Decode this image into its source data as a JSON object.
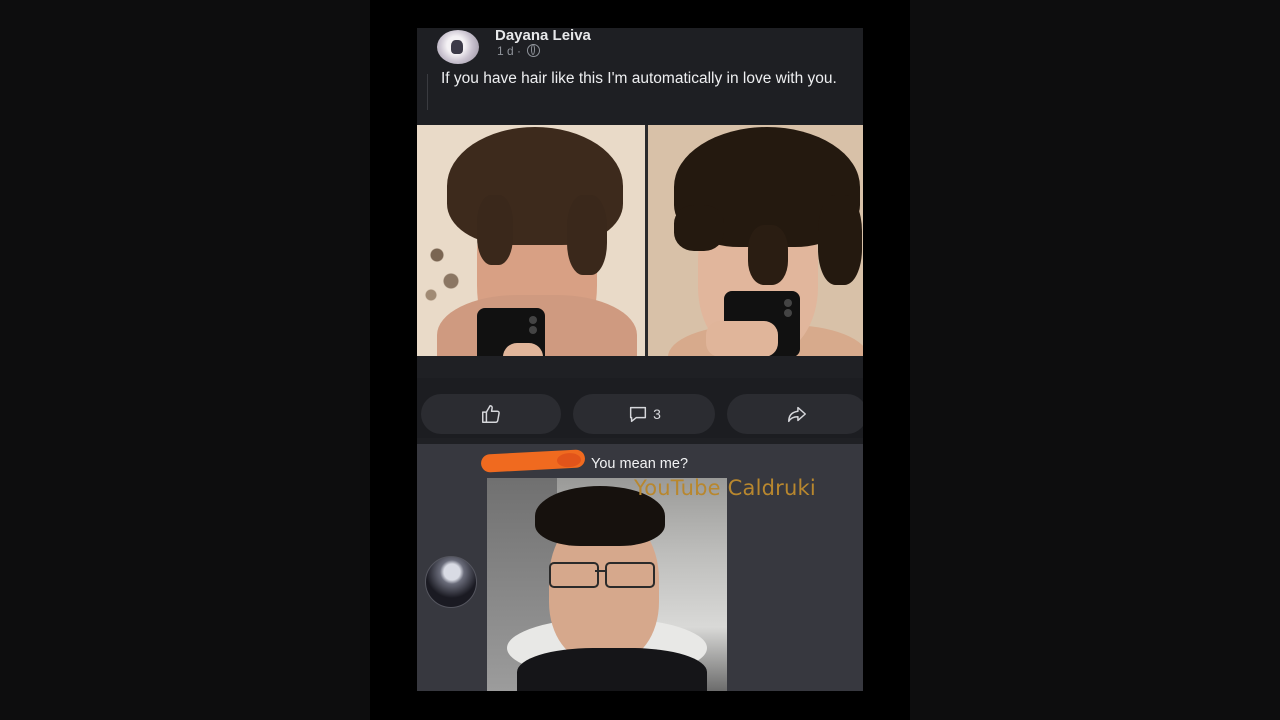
{
  "post": {
    "author_name": "Dayana Leiva",
    "meta": "1 d ·",
    "text": "If you have hair like this I'm automatically in love with you."
  },
  "actions": {
    "comment_count": "3"
  },
  "comment": {
    "text": "You mean me?",
    "watermark": "YouTube Caldruki"
  },
  "colors": {
    "card_bg": "#1f2024",
    "comment_bg": "#37383f",
    "redaction": "#f06a1f",
    "watermark": "#b8872e"
  },
  "icons": [
    "globe-icon",
    "thumbs-up-icon",
    "comment-icon",
    "share-icon"
  ]
}
